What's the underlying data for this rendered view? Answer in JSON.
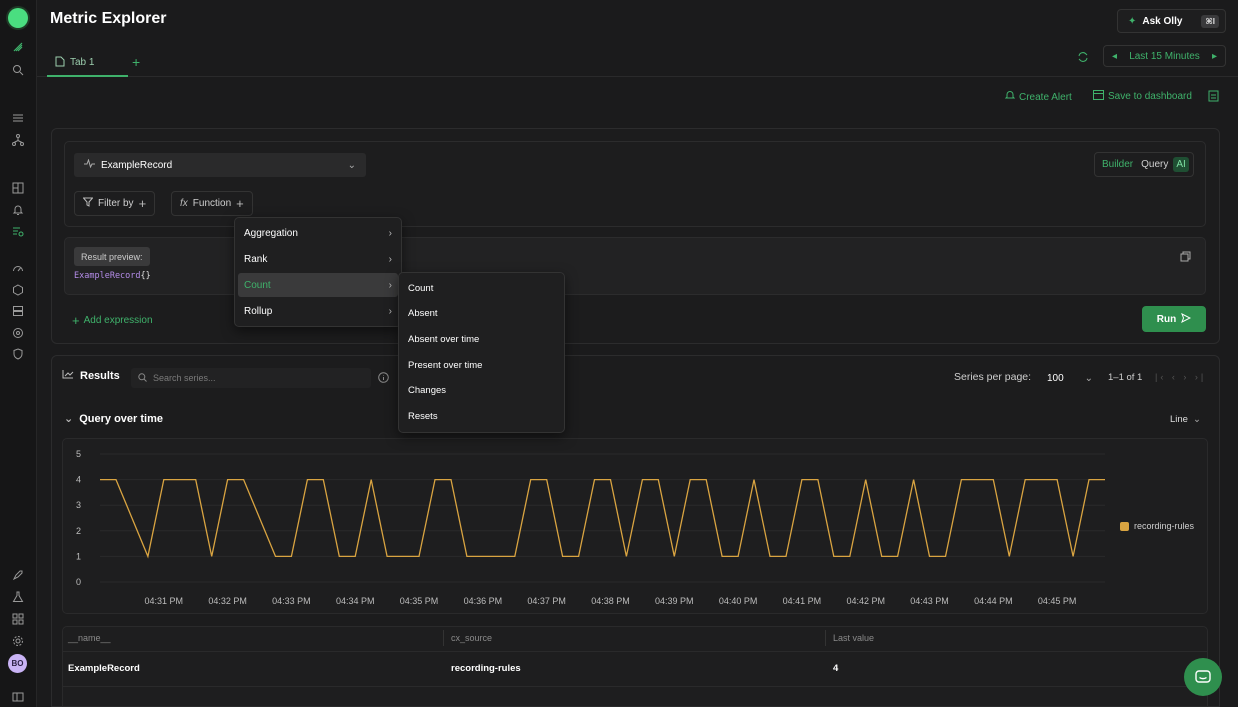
{
  "header": {
    "title": "Metric Explorer",
    "ask_olly": "Ask Olly",
    "ask_olly_shortcut": "⌘I"
  },
  "sidebar": {
    "avatar_initials": "BO"
  },
  "tabs": {
    "tab1": "Tab 1"
  },
  "time_range": "Last 15 Minutes",
  "actions": {
    "create_alert": "Create Alert",
    "save_dashboard": "Save to dashboard"
  },
  "query": {
    "metric": "ExampleRecord",
    "mode": {
      "builder": "Builder",
      "query": "Query",
      "ai": "AI"
    },
    "filter_by": "Filter by",
    "function": "Function",
    "preview_label": "Result preview:",
    "preview_metric": "ExampleRecord",
    "preview_braces": "{}",
    "add_expression": "Add expression",
    "run": "Run"
  },
  "function_menu": {
    "items": [
      "Aggregation",
      "Rank",
      "Count",
      "Rollup"
    ],
    "active": "Count",
    "submenu": [
      "Count",
      "Absent",
      "Absent over time",
      "Present over time",
      "Changes",
      "Resets"
    ]
  },
  "results": {
    "title": "Results",
    "search_placeholder": "Search series...",
    "series_per_page_label": "Series per page:",
    "series_per_page": "100",
    "range": "1–1 of 1",
    "section": "Query over time",
    "chart_type": "Line"
  },
  "colors": {
    "accent": "#3fb26b",
    "series": "#d9a441"
  },
  "chart_data": {
    "type": "line",
    "ylim": [
      0,
      5
    ],
    "yticks": [
      "0",
      "1",
      "2",
      "3",
      "4",
      "5"
    ],
    "xticks": [
      "04:31 PM",
      "04:32 PM",
      "04:33 PM",
      "04:34 PM",
      "04:35 PM",
      "04:36 PM",
      "04:37 PM",
      "04:38 PM",
      "04:39 PM",
      "04:40 PM",
      "04:41 PM",
      "04:42 PM",
      "04:43 PM",
      "04:44 PM",
      "04:45 PM"
    ],
    "series": [
      {
        "name": "recording-rules",
        "x": [
          30.0,
          30.25,
          30.75,
          31.0,
          31.5,
          31.75,
          32.0,
          32.25,
          32.75,
          33.0,
          33.25,
          33.5,
          33.75,
          34.0,
          34.25,
          34.5,
          34.75,
          35.0,
          35.25,
          35.5,
          35.75,
          36.0,
          36.25,
          36.5,
          36.75,
          37.0,
          37.25,
          37.5,
          37.75,
          38.0,
          38.25,
          38.5,
          38.75,
          39.0,
          39.25,
          39.5,
          39.75,
          40.0,
          40.25,
          40.5,
          40.75,
          41.0,
          41.25,
          41.5,
          41.75,
          42.0,
          42.25,
          42.5,
          42.75,
          43.0,
          43.25,
          43.5,
          43.75,
          44.0,
          44.25,
          44.5,
          44.75,
          45.0,
          45.25,
          45.5,
          45.75
        ],
        "y": [
          4,
          4,
          1,
          4,
          4,
          1,
          4,
          4,
          1,
          1,
          4,
          4,
          1,
          1,
          4,
          1,
          1,
          1,
          4,
          4,
          1,
          1,
          1,
          1,
          4,
          4,
          1,
          1,
          4,
          4,
          1,
          4,
          4,
          1,
          4,
          4,
          1,
          1,
          4,
          1,
          1,
          4,
          4,
          1,
          1,
          4,
          1,
          1,
          4,
          1,
          1,
          4,
          4,
          4,
          1,
          4,
          4,
          4,
          1,
          4,
          4
        ]
      }
    ],
    "legend": "right"
  },
  "table": {
    "headers": [
      "__name__",
      "cx_source",
      "Last value"
    ],
    "rows": [
      [
        "ExampleRecord",
        "recording-rules",
        "4"
      ]
    ]
  }
}
